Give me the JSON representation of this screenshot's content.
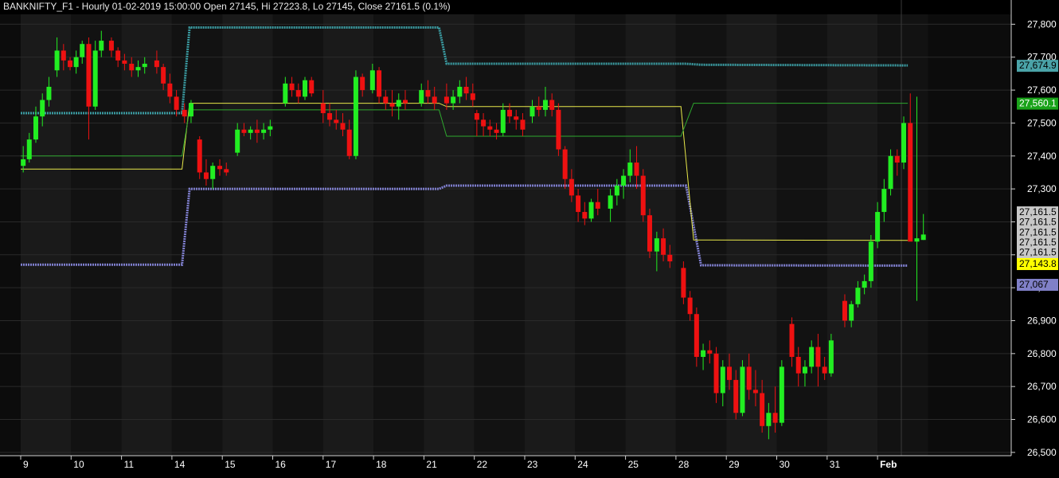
{
  "chart_data": {
    "type": "candlestick",
    "title": "BANKNIFTY_F1 - Hourly 01-02-2019 15:00:00 Open 27145, Hi 27223.8, Lo 27145, Close 27161.5 (0.1%)",
    "x_labels": [
      "9",
      "10",
      "11",
      "14",
      "15",
      "16",
      "17",
      "18",
      "21",
      "22",
      "23",
      "24",
      "25",
      "28",
      "29",
      "30",
      "31",
      "Feb"
    ],
    "y_ticks": [
      "26,500",
      "26,600",
      "26,700",
      "26,800",
      "26,900",
      "27,000",
      "27,100",
      "27,200",
      "27,300",
      "27,400",
      "27,500",
      "27,600",
      "27,700",
      "27,800"
    ],
    "y_tick_values": [
      26500,
      26600,
      26700,
      26800,
      26900,
      27000,
      27100,
      27200,
      27300,
      27400,
      27500,
      27600,
      27700,
      27800
    ],
    "ylim": [
      26490,
      27830
    ],
    "grid": true,
    "price_badges": [
      {
        "label": "27,674.9",
        "value": 27674.9,
        "color": "#4aa3a8",
        "text_color": "#000000"
      },
      {
        "label": "27,560.1",
        "value": 27560.1,
        "color": "#1aa31a",
        "text_color": "#ffffff"
      },
      {
        "label": "27,161.5",
        "value": 27230,
        "color": "#c8c8c8",
        "text_color": "#000000"
      },
      {
        "label": "27,161.5",
        "value": 27200,
        "color": "#c8c8c8",
        "text_color": "#000000"
      },
      {
        "label": "27,161.5",
        "value": 27168,
        "color": "#c8c8c8",
        "text_color": "#000000"
      },
      {
        "label": "27,161.5",
        "value": 27138,
        "color": "#c8c8c8",
        "text_color": "#000000"
      },
      {
        "label": "27,161.5",
        "value": 27108,
        "color": "#c8c8c8",
        "text_color": "#000000"
      },
      {
        "label": "27,143.8",
        "value": 27073,
        "color": "#ffff00",
        "text_color": "#000000"
      },
      {
        "label": "27,067",
        "value": 27010,
        "color": "#8080c8",
        "text_color": "#000000"
      }
    ],
    "series": [
      {
        "style": "channel-upper",
        "color": "#3a9aa0",
        "values": [
          [
            0,
            27530
          ],
          [
            3.2,
            27530
          ],
          [
            3.35,
            27790
          ],
          [
            8.3,
            27790
          ],
          [
            8.45,
            27680
          ],
          [
            13.2,
            27680
          ],
          [
            13.5,
            27677
          ],
          [
            17.6,
            27675
          ]
        ]
      },
      {
        "style": "channel-lower",
        "color": "#8080d0",
        "values": [
          [
            0,
            27070
          ],
          [
            3.2,
            27070
          ],
          [
            3.35,
            27300
          ],
          [
            8.3,
            27300
          ],
          [
            8.45,
            27310
          ],
          [
            13.2,
            27310
          ],
          [
            13.5,
            27068
          ],
          [
            17.6,
            27067
          ]
        ]
      },
      {
        "style": "line",
        "color": "#e8e84a",
        "values": [
          [
            0,
            27360
          ],
          [
            3.2,
            27360
          ],
          [
            3.35,
            27560
          ],
          [
            8.3,
            27560
          ],
          [
            8.45,
            27550
          ],
          [
            13.1,
            27550
          ],
          [
            13.35,
            27145
          ],
          [
            17.6,
            27143.8
          ]
        ]
      },
      {
        "style": "line",
        "color": "#2ea82e",
        "values": [
          [
            0,
            27400
          ],
          [
            3.2,
            27400
          ],
          [
            3.35,
            27540
          ],
          [
            8.3,
            27540
          ],
          [
            8.45,
            27460
          ],
          [
            13.1,
            27460
          ],
          [
            13.35,
            27560
          ],
          [
            17.6,
            27560.1
          ]
        ]
      }
    ],
    "candles": [
      [
        0.05,
        27370,
        27430,
        27350,
        27390
      ],
      [
        0.17,
        27390,
        27470,
        27380,
        27450
      ],
      [
        0.3,
        27450,
        27550,
        27440,
        27520
      ],
      [
        0.43,
        27520,
        27590,
        27490,
        27570
      ],
      [
        0.56,
        27570,
        27640,
        27550,
        27610
      ],
      [
        0.72,
        27660,
        27760,
        27640,
        27720
      ],
      [
        0.85,
        27720,
        27740,
        27660,
        27690
      ],
      [
        0.98,
        27690,
        27700,
        27660,
        27670
      ],
      [
        1.1,
        27670,
        27720,
        27650,
        27700
      ],
      [
        1.22,
        27700,
        27750,
        27680,
        27740
      ],
      [
        1.35,
        27740,
        27760,
        27450,
        27550
      ],
      [
        1.48,
        27550,
        27750,
        27540,
        27720
      ],
      [
        1.6,
        27720,
        27780,
        27700,
        27750
      ],
      [
        1.8,
        27750,
        27760,
        27700,
        27720
      ],
      [
        1.93,
        27720,
        27730,
        27670,
        27690
      ],
      [
        2.06,
        27690,
        27710,
        27660,
        27680
      ],
      [
        2.2,
        27680,
        27700,
        27640,
        27660
      ],
      [
        2.33,
        27660,
        27690,
        27640,
        27670
      ],
      [
        2.46,
        27670,
        27700,
        27650,
        27680
      ],
      [
        2.7,
        27690,
        27720,
        27650,
        27670
      ],
      [
        2.83,
        27670,
        27680,
        27600,
        27620
      ],
      [
        2.96,
        27620,
        27650,
        27560,
        27580
      ],
      [
        3.09,
        27580,
        27600,
        27520,
        27540
      ],
      [
        3.25,
        27540,
        27560,
        27500,
        27520
      ],
      [
        3.38,
        27520,
        27570,
        27500,
        27560
      ],
      [
        3.55,
        27450,
        27460,
        27330,
        27350
      ],
      [
        3.68,
        27350,
        27390,
        27310,
        27330
      ],
      [
        3.81,
        27330,
        27380,
        27300,
        27370
      ],
      [
        3.95,
        27370,
        27390,
        27340,
        27360
      ],
      [
        4.08,
        27360,
        27380,
        27340,
        27350
      ],
      [
        4.3,
        27410,
        27500,
        27400,
        27480
      ],
      [
        4.43,
        27480,
        27500,
        27460,
        27470
      ],
      [
        4.56,
        27470,
        27490,
        27450,
        27480
      ],
      [
        4.69,
        27480,
        27510,
        27440,
        27470
      ],
      [
        4.82,
        27470,
        27500,
        27450,
        27480
      ],
      [
        4.95,
        27480,
        27510,
        27460,
        27490
      ],
      [
        5.25,
        27560,
        27640,
        27550,
        27620
      ],
      [
        5.38,
        27620,
        27640,
        27580,
        27600
      ],
      [
        5.51,
        27600,
        27620,
        27560,
        27580
      ],
      [
        5.64,
        27580,
        27640,
        27570,
        27630
      ],
      [
        5.77,
        27630,
        27640,
        27580,
        27590
      ],
      [
        6.0,
        27560,
        27600,
        27500,
        27530
      ],
      [
        6.13,
        27530,
        27560,
        27490,
        27510
      ],
      [
        6.26,
        27510,
        27540,
        27480,
        27500
      ],
      [
        6.39,
        27500,
        27530,
        27460,
        27480
      ],
      [
        6.52,
        27480,
        27510,
        27390,
        27400
      ],
      [
        6.65,
        27400,
        27660,
        27390,
        27640
      ],
      [
        6.78,
        27640,
        27650,
        27580,
        27600
      ],
      [
        6.98,
        27600,
        27680,
        27590,
        27660
      ],
      [
        7.11,
        27660,
        27670,
        27560,
        27580
      ],
      [
        7.24,
        27580,
        27600,
        27540,
        27560
      ],
      [
        7.37,
        27560,
        27600,
        27520,
        27550
      ],
      [
        7.5,
        27550,
        27590,
        27510,
        27570
      ],
      [
        7.63,
        27570,
        27600,
        27540,
        27560
      ],
      [
        7.95,
        27560,
        27620,
        27550,
        27600
      ],
      [
        8.08,
        27600,
        27630,
        27560,
        27580
      ],
      [
        8.21,
        27580,
        27610,
        27540,
        27560
      ],
      [
        8.45,
        27580,
        27620,
        27540,
        27560
      ],
      [
        8.58,
        27560,
        27600,
        27540,
        27580
      ],
      [
        8.71,
        27580,
        27630,
        27560,
        27610
      ],
      [
        8.84,
        27610,
        27640,
        27570,
        27590
      ],
      [
        8.97,
        27590,
        27620,
        27550,
        27570
      ],
      [
        9.05,
        27530,
        27540,
        27460,
        27510
      ],
      [
        9.18,
        27510,
        27530,
        27460,
        27490
      ],
      [
        9.31,
        27490,
        27510,
        27460,
        27480
      ],
      [
        9.44,
        27480,
        27500,
        27450,
        27470
      ],
      [
        9.57,
        27470,
        27560,
        27460,
        27540
      ],
      [
        9.7,
        27540,
        27560,
        27500,
        27520
      ],
      [
        9.83,
        27520,
        27540,
        27480,
        27510
      ],
      [
        9.96,
        27510,
        27530,
        27460,
        27480
      ],
      [
        10.15,
        27520,
        27570,
        27500,
        27550
      ],
      [
        10.28,
        27550,
        27580,
        27520,
        27540
      ],
      [
        10.41,
        27540,
        27610,
        27520,
        27570
      ],
      [
        10.54,
        27570,
        27590,
        27520,
        27540
      ],
      [
        10.67,
        27540,
        27560,
        27400,
        27420
      ],
      [
        10.8,
        27420,
        27430,
        27300,
        27330
      ],
      [
        10.93,
        27330,
        27360,
        27260,
        27280
      ],
      [
        11.06,
        27280,
        27300,
        27200,
        27230
      ],
      [
        11.19,
        27230,
        27260,
        27190,
        27210
      ],
      [
        11.32,
        27210,
        27270,
        27200,
        27260
      ],
      [
        11.45,
        27260,
        27300,
        27220,
        27240
      ],
      [
        11.7,
        27240,
        27300,
        27200,
        27280
      ],
      [
        11.83,
        27280,
        27330,
        27250,
        27310
      ],
      [
        11.96,
        27310,
        27360,
        27270,
        27340
      ],
      [
        12.09,
        27340,
        27420,
        27320,
        27380
      ],
      [
        12.22,
        27380,
        27430,
        27300,
        27340
      ],
      [
        12.35,
        27340,
        27360,
        27200,
        27220
      ],
      [
        12.48,
        27220,
        27240,
        27090,
        27110
      ],
      [
        12.62,
        27110,
        27170,
        27050,
        27150
      ],
      [
        12.75,
        27150,
        27180,
        27080,
        27100
      ],
      [
        12.88,
        27100,
        27130,
        27060,
        27080
      ],
      [
        13.15,
        27060,
        27080,
        26950,
        26970
      ],
      [
        13.28,
        26970,
        26990,
        26900,
        26920
      ],
      [
        13.41,
        26920,
        26940,
        26760,
        26790
      ],
      [
        13.54,
        26790,
        26830,
        26750,
        26810
      ],
      [
        13.67,
        26810,
        26840,
        26770,
        26800
      ],
      [
        13.8,
        26800,
        26820,
        26650,
        26680
      ],
      [
        13.93,
        26680,
        26780,
        26640,
        26760
      ],
      [
        14.06,
        26760,
        26800,
        26690,
        26720
      ],
      [
        14.19,
        26720,
        26750,
        26600,
        26620
      ],
      [
        14.32,
        26620,
        26780,
        26610,
        26760
      ],
      [
        14.45,
        26760,
        26800,
        26660,
        26690
      ],
      [
        14.58,
        26690,
        26750,
        26640,
        26680
      ],
      [
        14.71,
        26680,
        26720,
        26560,
        26580
      ],
      [
        14.84,
        26580,
        26650,
        26540,
        26620
      ],
      [
        14.97,
        26620,
        26700,
        26560,
        26590
      ],
      [
        15.1,
        26590,
        26780,
        26580,
        26760
      ],
      [
        15.3,
        26890,
        26910,
        26760,
        26790
      ],
      [
        15.43,
        26790,
        26820,
        26700,
        26740
      ],
      [
        15.56,
        26740,
        26780,
        26700,
        26760
      ],
      [
        15.69,
        26760,
        26840,
        26740,
        26820
      ],
      [
        15.82,
        26820,
        26860,
        26700,
        26760
      ],
      [
        15.95,
        26760,
        26790,
        26720,
        26740
      ],
      [
        16.08,
        26740,
        26860,
        26730,
        26840
      ],
      [
        16.35,
        26960,
        26980,
        26880,
        26900
      ],
      [
        16.48,
        26900,
        26960,
        26880,
        26950
      ],
      [
        16.61,
        26950,
        27020,
        26940,
        27000
      ],
      [
        16.74,
        27000,
        27040,
        26980,
        27020
      ],
      [
        16.87,
        27020,
        27160,
        27000,
        27140
      ],
      [
        17.0,
        27140,
        27260,
        27120,
        27230
      ],
      [
        17.13,
        27230,
        27330,
        27200,
        27300
      ],
      [
        17.26,
        27300,
        27420,
        27280,
        27400
      ],
      [
        17.39,
        27400,
        27420,
        27340,
        27380
      ],
      [
        17.52,
        27380,
        27520,
        27360,
        27500
      ],
      [
        17.65,
        27500,
        27590,
        27200,
        27140
      ],
      [
        17.78,
        27140,
        27580,
        26960,
        27150
      ],
      [
        17.91,
        27145,
        27223.8,
        27145,
        27161.5
      ]
    ]
  }
}
